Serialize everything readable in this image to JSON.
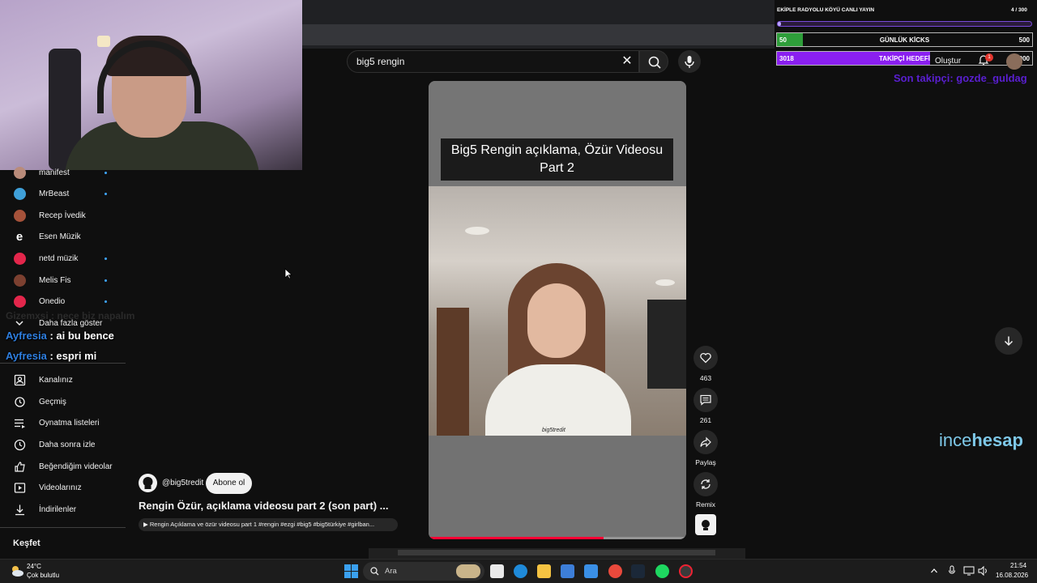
{
  "search": {
    "query": "big5 rengin"
  },
  "sidebar": {
    "subscriptions": [
      {
        "label": "manifest",
        "avatar_color": "#b98b7a",
        "has_dot": true
      },
      {
        "label": "MrBeast",
        "avatar_color": "#3fa0d9",
        "has_dot": true
      },
      {
        "label": "Recep İvedik",
        "avatar_color": "#a5523a",
        "has_dot": false
      },
      {
        "label": "Esen Müzik",
        "avatar_color": "#0f0f0f",
        "has_dot": false
      },
      {
        "label": "netd müzik",
        "avatar_color": "#e3264b",
        "has_dot": true
      },
      {
        "label": "Melis Fis",
        "avatar_color": "#7c4030",
        "has_dot": true
      },
      {
        "label": "Onedio",
        "avatar_color": "#e3264b",
        "has_dot": true
      }
    ],
    "show_more": "Daha fazla göster",
    "you_items": [
      {
        "label": "Kanalınız",
        "icon": "user-box-icon"
      },
      {
        "label": "Geçmiş",
        "icon": "history-icon"
      },
      {
        "label": "Oynatma listeleri",
        "icon": "playlist-icon"
      },
      {
        "label": "Daha sonra izle",
        "icon": "clock-icon"
      },
      {
        "label": "Beğendiğim videolar",
        "icon": "thumbs-up-icon"
      },
      {
        "label": "Videolarınız",
        "icon": "video-icon"
      },
      {
        "label": "İndirilenler",
        "icon": "download-icon"
      }
    ],
    "explore": "Keşfet"
  },
  "chat": {
    "faded": "Gizemxsi : nece biz napalım",
    "messages": [
      {
        "user": "Ayfresia",
        "text": ": ai bu bence"
      },
      {
        "user": "Ayfresia",
        "text": ": espri mi"
      }
    ]
  },
  "short": {
    "caption": "Big5 Rengin açıklama, Özür Videosu Part 2",
    "watermark": "big5tredit",
    "progress": 0.68,
    "actions": {
      "likes": "463",
      "comments": "261",
      "share": "Paylaş",
      "remix": "Remix"
    },
    "channel": "@big5tredit",
    "subscribe": "Abone ol",
    "title": "Rengin Özür, açıklama videosu part 2 (son part) ...",
    "related": "▶ Rengin Açıklama ve özür videosu part 1 #rengin #ezgi #big5 #big5türkiye #girlban..."
  },
  "header": {
    "create": "Oluştur",
    "notifications": "1"
  },
  "overlay": {
    "title": "EKİPLE RADYOLU KÖYÜ CANLI YAYIN",
    "goal_count": "4 / 300",
    "goal_progress": 0.013,
    "kicks": {
      "left": "50",
      "label": "GÜNLÜK KİCKS",
      "right": "500",
      "progress": 0.1,
      "color": "#2e9e3a"
    },
    "followers": {
      "left": "3018",
      "label": "TAKİPÇİ HEDEFİ",
      "right": "5000",
      "progress": 0.6,
      "color": "#8a1ff0"
    },
    "last_follower": "Son takipçi: gozde_guldag",
    "brand_a": "ince",
    "brand_b": "hesap"
  },
  "taskbar": {
    "temperature": "24°C",
    "weather": "Çok bulutlu",
    "search": "Ara",
    "time": "21:54",
    "date": "16.08.2026"
  }
}
